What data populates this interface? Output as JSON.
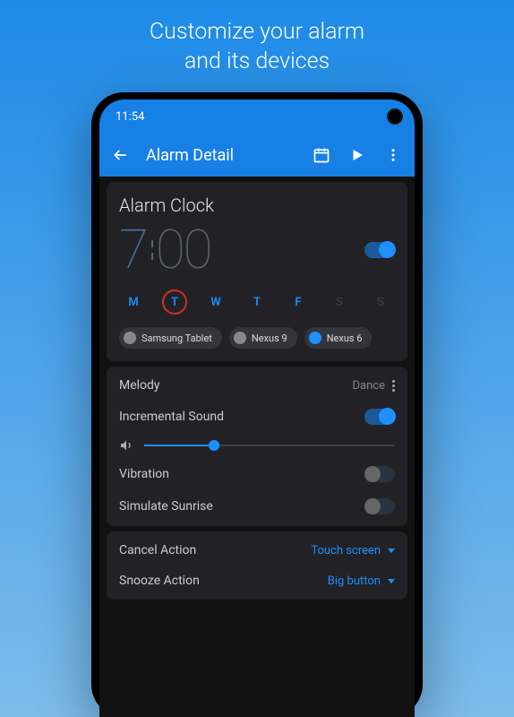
{
  "promo": {
    "line1": "Customize your alarm",
    "line2": "and its devices"
  },
  "status_bar": {
    "time": "11:54"
  },
  "app_bar": {
    "title": "Alarm Detail"
  },
  "alarm": {
    "name": "Alarm Clock",
    "hours": "7",
    "minutes": "00",
    "enabled": true,
    "days": [
      {
        "label": "M",
        "active": true,
        "selected": false
      },
      {
        "label": "T",
        "active": true,
        "selected": true
      },
      {
        "label": "W",
        "active": true,
        "selected": false
      },
      {
        "label": "T",
        "active": true,
        "selected": false
      },
      {
        "label": "F",
        "active": true,
        "selected": false
      },
      {
        "label": "S",
        "active": false,
        "selected": false
      },
      {
        "label": "S",
        "active": false,
        "selected": false
      }
    ],
    "devices": [
      {
        "name": "Samsung Tablet",
        "highlight": false
      },
      {
        "name": "Nexus 9",
        "highlight": false
      },
      {
        "name": "Nexus 6",
        "highlight": true
      }
    ]
  },
  "sound": {
    "melody_label": "Melody",
    "melody_value": "Dance",
    "incremental_label": "Incremental Sound",
    "incremental_on": true,
    "volume_pct": 28,
    "vibration_label": "Vibration",
    "vibration_on": false,
    "sunrise_label": "Simulate Sunrise",
    "sunrise_on": false
  },
  "actions": {
    "cancel_label": "Cancel Action",
    "cancel_value": "Touch screen",
    "snooze_label": "Snooze Action",
    "snooze_value": "Big button"
  }
}
